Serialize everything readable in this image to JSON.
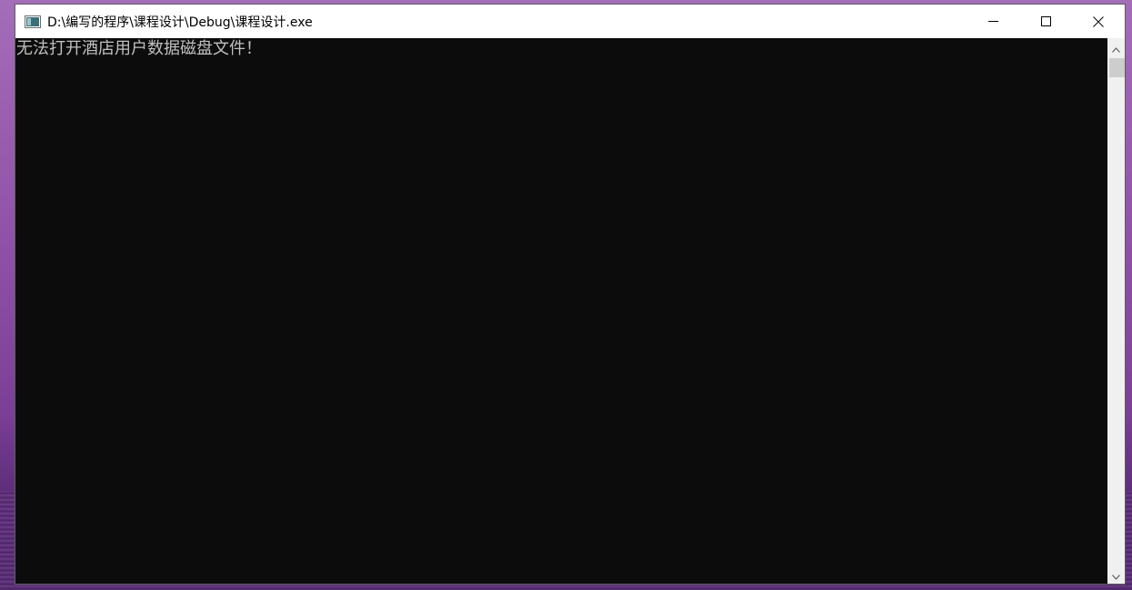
{
  "window": {
    "title": "D:\\编写的程序\\课程设计\\Debug\\课程设计.exe",
    "app_icon": "console-app-icon",
    "controls": {
      "minimize": "minimize-icon",
      "maximize": "maximize-icon",
      "close": "close-icon"
    }
  },
  "console": {
    "lines": [
      "无法打开酒店用户数据磁盘文件！"
    ],
    "background": "#0c0c0c",
    "text_color": "#c0c0c0"
  },
  "scrollbar": {
    "up_icon": "chevron-up-icon",
    "down_icon": "chevron-down-icon"
  }
}
